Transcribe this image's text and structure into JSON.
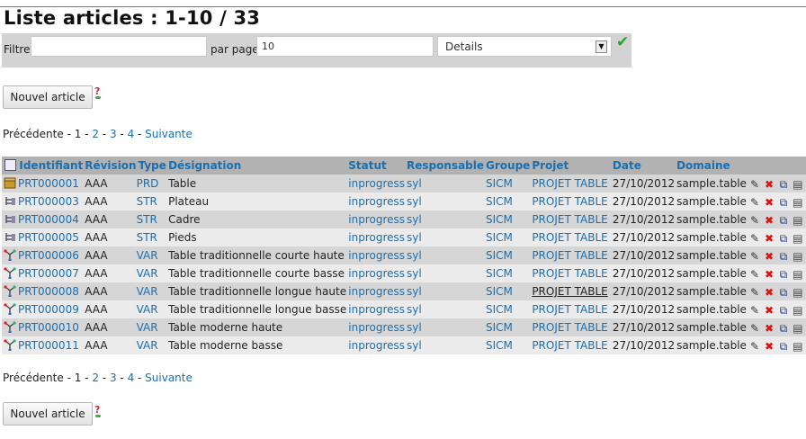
{
  "page": {
    "title": "Liste articles : 1-10 / 33"
  },
  "filter": {
    "label": "Filtre",
    "value": "",
    "per_page_label": "par page",
    "per_page_value": "10",
    "view_value": "Details"
  },
  "buttons": {
    "new_article": "Nouvel article"
  },
  "pager": {
    "prev": "Précédente",
    "sep": " - ",
    "current": "1",
    "pages": [
      "2",
      "3",
      "4"
    ],
    "next": "Suivante"
  },
  "table": {
    "headers": [
      "Identifiant",
      "Révision",
      "Type",
      "Désignation",
      "Statut",
      "Responsable",
      "Groupe",
      "Projet",
      "Date",
      "Domaine"
    ],
    "rows": [
      {
        "icon": "package-icon",
        "id": "PRT000001",
        "rev": "AAA",
        "type": "PRD",
        "designation": "Table",
        "statut": "inprogress",
        "resp": "syl",
        "groupe": "SICM",
        "projet": "PROJET TABLE",
        "date": "27/10/2012",
        "domaine": "sample.table"
      },
      {
        "icon": "structure-icon",
        "id": "PRT000003",
        "rev": "AAA",
        "type": "STR",
        "designation": "Plateau",
        "statut": "inprogress",
        "resp": "syl",
        "groupe": "SICM",
        "projet": "PROJET TABLE",
        "date": "27/10/2012",
        "domaine": "sample.table"
      },
      {
        "icon": "structure-icon",
        "id": "PRT000004",
        "rev": "AAA",
        "type": "STR",
        "designation": "Cadre",
        "statut": "inprogress",
        "resp": "syl",
        "groupe": "SICM",
        "projet": "PROJET TABLE",
        "date": "27/10/2012",
        "domaine": "sample.table"
      },
      {
        "icon": "structure-icon",
        "id": "PRT000005",
        "rev": "AAA",
        "type": "STR",
        "designation": "Pieds",
        "statut": "inprogress",
        "resp": "syl",
        "groupe": "SICM",
        "projet": "PROJET TABLE",
        "date": "27/10/2012",
        "domaine": "sample.table"
      },
      {
        "icon": "variant-icon",
        "id": "PRT000006",
        "rev": "AAA",
        "type": "VAR",
        "designation": "Table traditionnelle courte haute",
        "statut": "inprogress",
        "resp": "syl",
        "groupe": "SICM",
        "projet": "PROJET TABLE",
        "date": "27/10/2012",
        "domaine": "sample.table"
      },
      {
        "icon": "variant-icon",
        "id": "PRT000007",
        "rev": "AAA",
        "type": "VAR",
        "designation": "Table traditionnelle courte basse",
        "statut": "inprogress",
        "resp": "syl",
        "groupe": "SICM",
        "projet": "PROJET TABLE",
        "date": "27/10/2012",
        "domaine": "sample.table"
      },
      {
        "icon": "variant-icon",
        "id": "PRT000008",
        "rev": "AAA",
        "type": "VAR",
        "designation": "Table traditionnelle longue haute",
        "statut": "inprogress",
        "resp": "syl",
        "groupe": "SICM",
        "projet": "PROJET TABLE",
        "date": "27/10/2012",
        "domaine": "sample.table"
      },
      {
        "icon": "variant-icon",
        "id": "PRT000009",
        "rev": "AAA",
        "type": "VAR",
        "designation": "Table traditionnelle longue basse",
        "statut": "inprogress",
        "resp": "syl",
        "groupe": "SICM",
        "projet": "PROJET TABLE",
        "date": "27/10/2012",
        "domaine": "sample.table"
      },
      {
        "icon": "variant-icon",
        "id": "PRT000010",
        "rev": "AAA",
        "type": "VAR",
        "designation": "Table moderne haute",
        "statut": "inprogress",
        "resp": "syl",
        "groupe": "SICM",
        "projet": "PROJET TABLE",
        "date": "27/10/2012",
        "domaine": "sample.table"
      },
      {
        "icon": "variant-icon",
        "id": "PRT000011",
        "rev": "AAA",
        "type": "VAR",
        "designation": "Table moderne basse",
        "statut": "inprogress",
        "resp": "syl",
        "groupe": "SICM",
        "projet": "PROJET TABLE",
        "date": "27/10/2012",
        "domaine": "sample.table"
      }
    ],
    "actions": [
      "edit-icon",
      "delete-icon",
      "copy-icon",
      "clipboard-icon"
    ]
  },
  "colors": {
    "link": "#1a6fb0",
    "header_bg": "#b2b2b2",
    "row_odd": "#d6d6d6",
    "row_even": "#ebebeb",
    "filter_bg": "#d3d3d3",
    "ok": "#2fa12f"
  }
}
